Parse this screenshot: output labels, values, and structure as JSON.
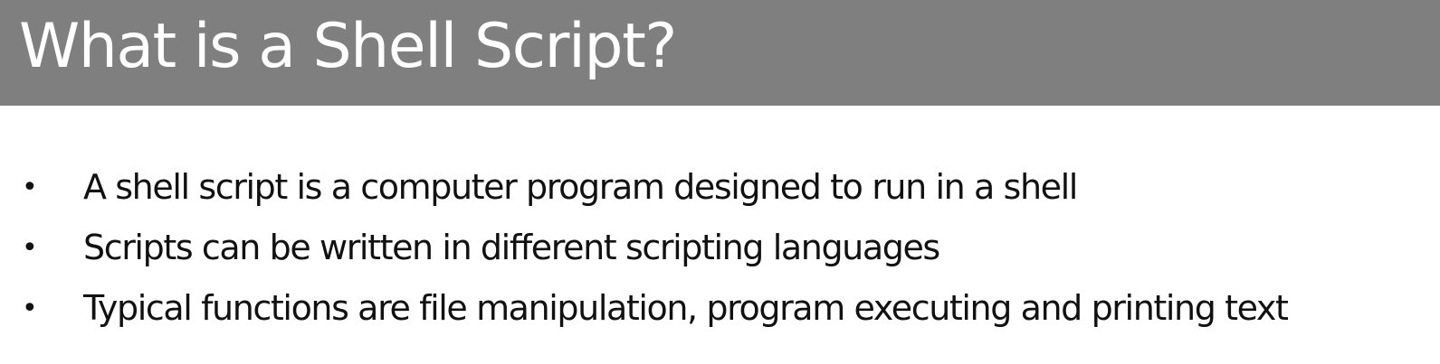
{
  "slide": {
    "title": "What is a Shell Script?",
    "bullets": [
      {
        "marker": "•",
        "text": "A shell script is a computer program designed to run in a shell"
      },
      {
        "marker": "•",
        "text": "Scripts can be written in different scripting languages"
      },
      {
        "marker": "•",
        "text": "Typical functions are file manipulation, program executing and printing text"
      }
    ],
    "colors": {
      "title_bar": "#7f7f7f",
      "title_text": "#ffffff",
      "body_text": "#111111",
      "background": "#ffffff"
    }
  }
}
